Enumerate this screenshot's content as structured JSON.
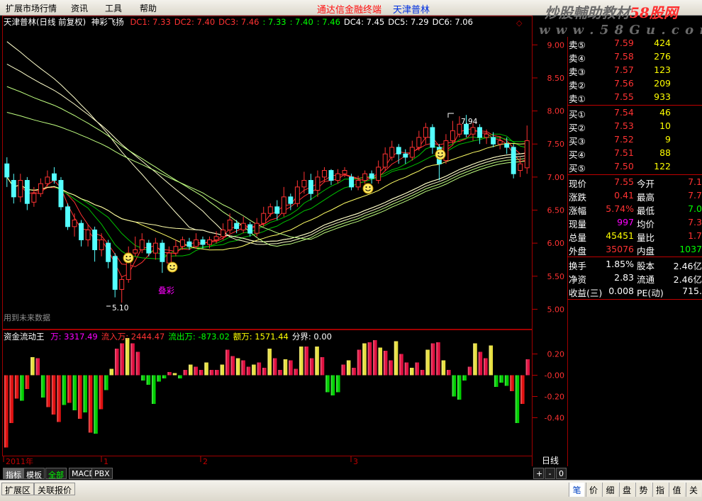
{
  "colors": {
    "up": "#ff3232",
    "down": "#54ffff",
    "grid": "#a00000",
    "axis": "#c00000",
    "yellow": "#ffff00",
    "white": "#ffffff",
    "green": "#00ff00"
  },
  "menu": {
    "items": [
      "扩展市场行情",
      "资讯",
      "工具",
      "帮助"
    ],
    "center_title": "通达信金融终端",
    "stock_title": "天津普林"
  },
  "watermark": {
    "line1": "炒股輔助教材",
    "line1b": "58股网",
    "line2": "w w w . 5 8 G u . c o m"
  },
  "chart_header": {
    "stock": "天津普林(日线 前复权)",
    "indicator": "神彩飞扬",
    "items": [
      {
        "label": "DC1: 7.33",
        "color": "#ff3232"
      },
      {
        "label": "DC2: 7.40",
        "color": "#ff3232"
      },
      {
        "label": "DC3: 7.46",
        "color": "#ff3232"
      },
      {
        "label": ": 7.33",
        "color": "#00ff00"
      },
      {
        "label": ": 7.40",
        "color": "#00ff00"
      },
      {
        "label": ": 7.46",
        "color": "#00ff00"
      },
      {
        "label": "DC4: 7.45",
        "color": "#ffffff"
      },
      {
        "label": "DC5: 7.29",
        "color": "#ffffff"
      },
      {
        "label": "DC6: 7.06",
        "color": "#ffffff"
      }
    ]
  },
  "chart_annotations": {
    "high": "7.94",
    "low": "5.10",
    "text_mark": "叠彩",
    "future_note": "用到未来数据"
  },
  "indicator_header": {
    "name": "资金流动王",
    "items": [
      {
        "label": "万: 3317.49",
        "color": "#ff00ff"
      },
      {
        "label": "流入万: 2444.47",
        "color": "#ff3232"
      },
      {
        "label": "流出万: -873.02",
        "color": "#00ff00"
      },
      {
        "label": "额万: 1571.44",
        "color": "#ffff00"
      },
      {
        "label": "分界: 0.00",
        "color": "#ffffff"
      }
    ]
  },
  "x_axis": {
    "labels": [
      "2011年",
      "1",
      "2",
      "3"
    ],
    "period": "日线"
  },
  "tabs": [
    "指标",
    "模板",
    "全部",
    "MACD",
    "PBX"
  ],
  "zoom_controls": [
    "+",
    "-",
    "0"
  ],
  "bottom_bar": {
    "items": [
      "扩展区",
      "关联报价"
    ],
    "right_tabs": [
      "笔",
      "价",
      "细",
      "盘",
      "势",
      "指",
      "值",
      "关"
    ]
  },
  "quote": {
    "asks": [
      {
        "label": "卖⑤",
        "price": "7.59",
        "vol": "424"
      },
      {
        "label": "卖④",
        "price": "7.58",
        "vol": "276"
      },
      {
        "label": "卖③",
        "price": "7.57",
        "vol": "123"
      },
      {
        "label": "卖②",
        "price": "7.56",
        "vol": "209"
      },
      {
        "label": "卖①",
        "price": "7.55",
        "vol": "933"
      }
    ],
    "bids": [
      {
        "label": "买①",
        "price": "7.54",
        "vol": "46"
      },
      {
        "label": "买②",
        "price": "7.53",
        "vol": "10"
      },
      {
        "label": "买③",
        "price": "7.52",
        "vol": "9"
      },
      {
        "label": "买④",
        "price": "7.51",
        "vol": "88"
      },
      {
        "label": "买⑤",
        "price": "7.50",
        "vol": "122"
      }
    ],
    "stats": [
      {
        "l1": "现价",
        "v1": "7.55",
        "c1": "#ff3232",
        "l2": "今开",
        "v2": "7.1",
        "c2": "#ff3232"
      },
      {
        "l1": "涨跌",
        "v1": "0.41",
        "c1": "#ff3232",
        "l2": "最高",
        "v2": "7.7",
        "c2": "#ff3232"
      },
      {
        "l1": "涨幅",
        "v1": "5.74%",
        "c1": "#ff3232",
        "l2": "最低",
        "v2": "7.0",
        "c2": "#00ff00"
      },
      {
        "l1": "现量",
        "v1": "997",
        "c1": "#ff00ff",
        "l2": "均价",
        "v2": "7.3",
        "c2": "#ff3232"
      },
      {
        "l1": "总量",
        "v1": "45451",
        "c1": "#ffff00",
        "l2": "量比",
        "v2": "1.7",
        "c2": "#ff3232"
      },
      {
        "l1": "外盘",
        "v1": "35076",
        "c1": "#ff3232",
        "l2": "内盘",
        "v2": "1037",
        "c2": "#00ff00"
      }
    ],
    "fin": [
      {
        "l1": "换手",
        "v1": "1.85%",
        "l2": "股本",
        "v2": "2.46亿"
      },
      {
        "l1": "净资",
        "v1": "2.83",
        "l2": "流通",
        "v2": "2.46亿"
      },
      {
        "l1": "收益(三)",
        "v1": "0.008",
        "l2": "PE(动)",
        "v2": "715."
      }
    ]
  },
  "chart_data": [
    {
      "type": "candlestick",
      "title": "天津普林(日线 前复权)",
      "y_ticks": [
        "9.00",
        "8.50",
        "8.00",
        "7.50",
        "7.00",
        "6.50",
        "6.00",
        "5.50",
        "5.00"
      ],
      "ylim": [
        4.94,
        9.1
      ],
      "candles": [
        [
          7.2,
          7.0,
          7.3,
          6.85
        ],
        [
          6.95,
          6.7,
          7.05,
          6.6
        ],
        [
          6.7,
          6.95,
          7.05,
          6.62
        ],
        [
          6.95,
          6.6,
          7.0,
          6.5
        ],
        [
          6.62,
          6.75,
          6.85,
          6.55
        ],
        [
          6.75,
          6.9,
          6.98,
          6.7
        ],
        [
          6.9,
          7.0,
          7.1,
          6.85
        ],
        [
          7.05,
          6.95,
          7.15,
          6.9
        ],
        [
          6.95,
          6.55,
          7.0,
          6.5
        ],
        [
          6.55,
          6.25,
          6.6,
          6.2
        ],
        [
          6.25,
          6.35,
          6.45,
          6.1
        ],
        [
          6.3,
          6.05,
          6.35,
          5.95
        ],
        [
          6.05,
          6.2,
          6.28,
          5.95
        ],
        [
          6.2,
          5.9,
          6.25,
          5.72
        ],
        [
          5.9,
          6.05,
          6.15,
          5.8
        ],
        [
          6.0,
          5.72,
          6.05,
          5.62
        ],
        [
          5.8,
          5.3,
          5.85,
          5.18
        ],
        [
          5.3,
          5.45,
          5.5,
          5.1
        ],
        [
          5.45,
          5.85,
          5.95,
          5.4
        ],
        [
          5.85,
          5.9,
          6.1,
          5.8
        ],
        [
          5.9,
          6.05,
          6.15,
          5.85
        ],
        [
          6.0,
          5.85,
          6.05,
          5.8
        ],
        [
          5.85,
          6.0,
          6.08,
          5.75
        ],
        [
          6.0,
          5.72,
          6.05,
          5.55
        ],
        [
          5.7,
          5.85,
          5.95,
          5.6
        ],
        [
          5.85,
          5.95,
          6.05,
          5.8
        ],
        [
          5.95,
          6.05,
          6.1,
          5.9
        ],
        [
          6.02,
          5.95,
          6.08,
          5.9
        ],
        [
          5.95,
          6.05,
          6.15,
          5.92
        ],
        [
          6.05,
          5.98,
          6.1,
          5.92
        ],
        [
          5.98,
          6.05,
          6.1,
          5.92
        ],
        [
          6.05,
          6.1,
          6.18,
          6.0
        ],
        [
          6.1,
          6.2,
          6.3,
          6.05
        ],
        [
          6.2,
          6.35,
          6.45,
          6.15
        ],
        [
          6.3,
          6.22,
          6.35,
          6.15
        ],
        [
          6.2,
          6.3,
          6.4,
          6.15
        ],
        [
          6.28,
          6.15,
          6.32,
          6.1
        ],
        [
          6.15,
          6.3,
          6.38,
          6.1
        ],
        [
          6.3,
          6.45,
          6.55,
          6.25
        ],
        [
          6.45,
          6.55,
          6.6,
          6.4
        ],
        [
          6.55,
          6.45,
          6.65,
          6.35
        ],
        [
          6.45,
          6.7,
          6.85,
          6.4
        ],
        [
          6.7,
          6.6,
          6.75,
          6.5
        ],
        [
          6.6,
          6.85,
          6.95,
          6.55
        ],
        [
          6.85,
          6.95,
          7.08,
          6.75
        ],
        [
          6.95,
          6.75,
          7.05,
          6.65
        ],
        [
          6.8,
          7.0,
          7.1,
          6.7
        ],
        [
          7.0,
          7.1,
          7.15,
          6.92
        ],
        [
          7.1,
          6.95,
          7.12,
          6.88
        ],
        [
          6.95,
          7.05,
          7.12,
          6.9
        ],
        [
          7.05,
          7.1,
          7.15,
          7.0
        ],
        [
          7.0,
          6.85,
          7.05,
          6.8
        ],
        [
          6.85,
          6.95,
          7.02,
          6.8
        ],
        [
          6.95,
          7.05,
          7.1,
          6.9
        ],
        [
          7.05,
          6.98,
          7.1,
          6.9
        ],
        [
          6.95,
          7.15,
          7.25,
          6.9
        ],
        [
          7.15,
          7.35,
          7.45,
          7.1
        ],
        [
          7.3,
          7.45,
          7.55,
          7.25
        ],
        [
          7.45,
          7.35,
          7.5,
          7.2
        ],
        [
          7.35,
          7.3,
          7.42,
          7.2
        ],
        [
          7.3,
          7.45,
          7.55,
          7.25
        ],
        [
          7.45,
          7.6,
          7.7,
          7.4
        ],
        [
          7.6,
          7.75,
          7.82,
          7.5
        ],
        [
          7.75,
          7.45,
          7.8,
          7.35
        ],
        [
          7.45,
          7.2,
          7.5,
          6.95
        ],
        [
          7.25,
          7.55,
          7.65,
          7.2
        ],
        [
          7.55,
          7.7,
          7.85,
          7.5
        ],
        [
          7.65,
          7.8,
          7.92,
          7.6
        ],
        [
          7.8,
          7.65,
          7.94,
          7.6
        ],
        [
          7.65,
          7.75,
          7.82,
          7.55
        ],
        [
          7.75,
          7.6,
          7.8,
          7.5
        ],
        [
          7.6,
          7.65,
          7.72,
          7.5
        ],
        [
          7.6,
          7.5,
          7.68,
          7.45
        ],
        [
          7.5,
          7.55,
          7.62,
          7.42
        ],
        [
          7.5,
          7.45,
          7.6,
          7.35
        ],
        [
          7.45,
          7.05,
          7.5,
          6.98
        ],
        [
          7.1,
          7.2,
          7.3,
          7.0
        ],
        [
          7.14,
          7.55,
          7.78,
          7.05
        ]
      ]
    },
    {
      "type": "bar",
      "title": "资金流动王",
      "y_ticks": [
        "0.20",
        "-0.00",
        "-0.20",
        "-0.40"
      ],
      "ylim": [
        -0.75,
        0.35
      ],
      "values": [
        -0.68,
        -0.45,
        -0.22,
        -0.24,
        -0.13,
        0.17,
        0.16,
        -0.21,
        -0.3,
        -0.37,
        -0.44,
        -0.28,
        -0.26,
        -0.33,
        -0.41,
        -0.35,
        -0.54,
        -0.55,
        -0.32,
        -0.14,
        0.06,
        0.25,
        0.3,
        0.35,
        0.3,
        0.22,
        -0.05,
        -0.09,
        -0.27,
        -0.06,
        -0.03,
        0.03,
        0.02,
        -0.03,
        0.05,
        0.1,
        0.08,
        0.05,
        0.12,
        0.05,
        0.05,
        0.1,
        0.24,
        0.18,
        0.16,
        0.14,
        0.08,
        0.1,
        0.12,
        0.07,
        0.25,
        0.16,
        0.05,
        0.15,
        0.14,
        0.06,
        0.27,
        0.27,
        0.16,
        0.27,
        0.17,
        -0.16,
        -0.19,
        -0.16,
        0.1,
        0.14,
        0.07,
        0.24,
        0.3,
        0.31,
        0.33,
        0.26,
        0.23,
        0.14,
        0.32,
        0.2,
        0.12,
        0.07,
        0.12,
        0.05,
        0.24,
        0.3,
        0.31,
        0.14,
        0.05,
        -0.2,
        -0.23,
        -0.05,
        0.08,
        0.3,
        0.22,
        0.16,
        0.28,
        -0.11,
        -0.07,
        -0.1,
        -0.15,
        -0.45,
        -0.27,
        0.15
      ]
    }
  ]
}
